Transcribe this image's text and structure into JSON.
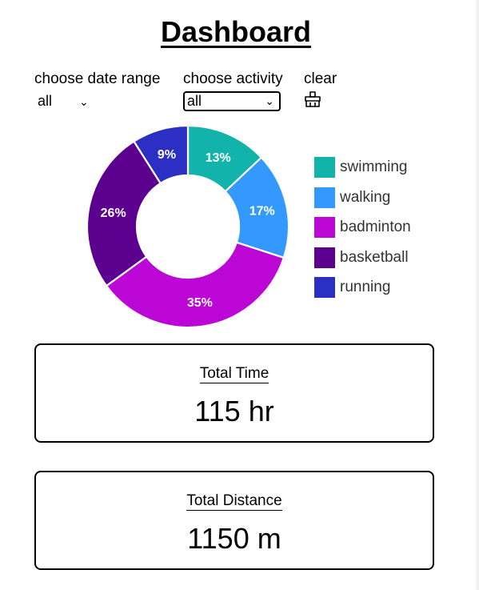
{
  "header": {
    "title": "Dashboard"
  },
  "filters": {
    "date_range": {
      "label": "choose date range",
      "value": "all"
    },
    "activity": {
      "label": "choose activity",
      "value": "all"
    },
    "clear": {
      "label": "clear",
      "icon": "broom-icon"
    }
  },
  "chart_data": {
    "type": "pie",
    "categories": [
      "swimming",
      "walking",
      "badminton",
      "basketball",
      "running"
    ],
    "values": [
      13,
      17,
      35,
      26,
      9
    ],
    "value_labels": [
      "13%",
      "17%",
      "35%",
      "26%",
      "9%"
    ],
    "colors": [
      "#12b3ab",
      "#3399ff",
      "#bb06d6",
      "#5c0090",
      "#2b2fc4"
    ],
    "legend_position": "right"
  },
  "legend": {
    "items": [
      {
        "label": "swimming",
        "color": "#12b3ab"
      },
      {
        "label": "walking",
        "color": "#3399ff"
      },
      {
        "label": "badminton",
        "color": "#bb06d6"
      },
      {
        "label": "basketball",
        "color": "#5c0090"
      },
      {
        "label": "running",
        "color": "#2b2fc4"
      }
    ]
  },
  "cards": [
    {
      "title": "Total Time",
      "value": "115 hr"
    },
    {
      "title": "Total Distance",
      "value": "1150 m"
    }
  ]
}
